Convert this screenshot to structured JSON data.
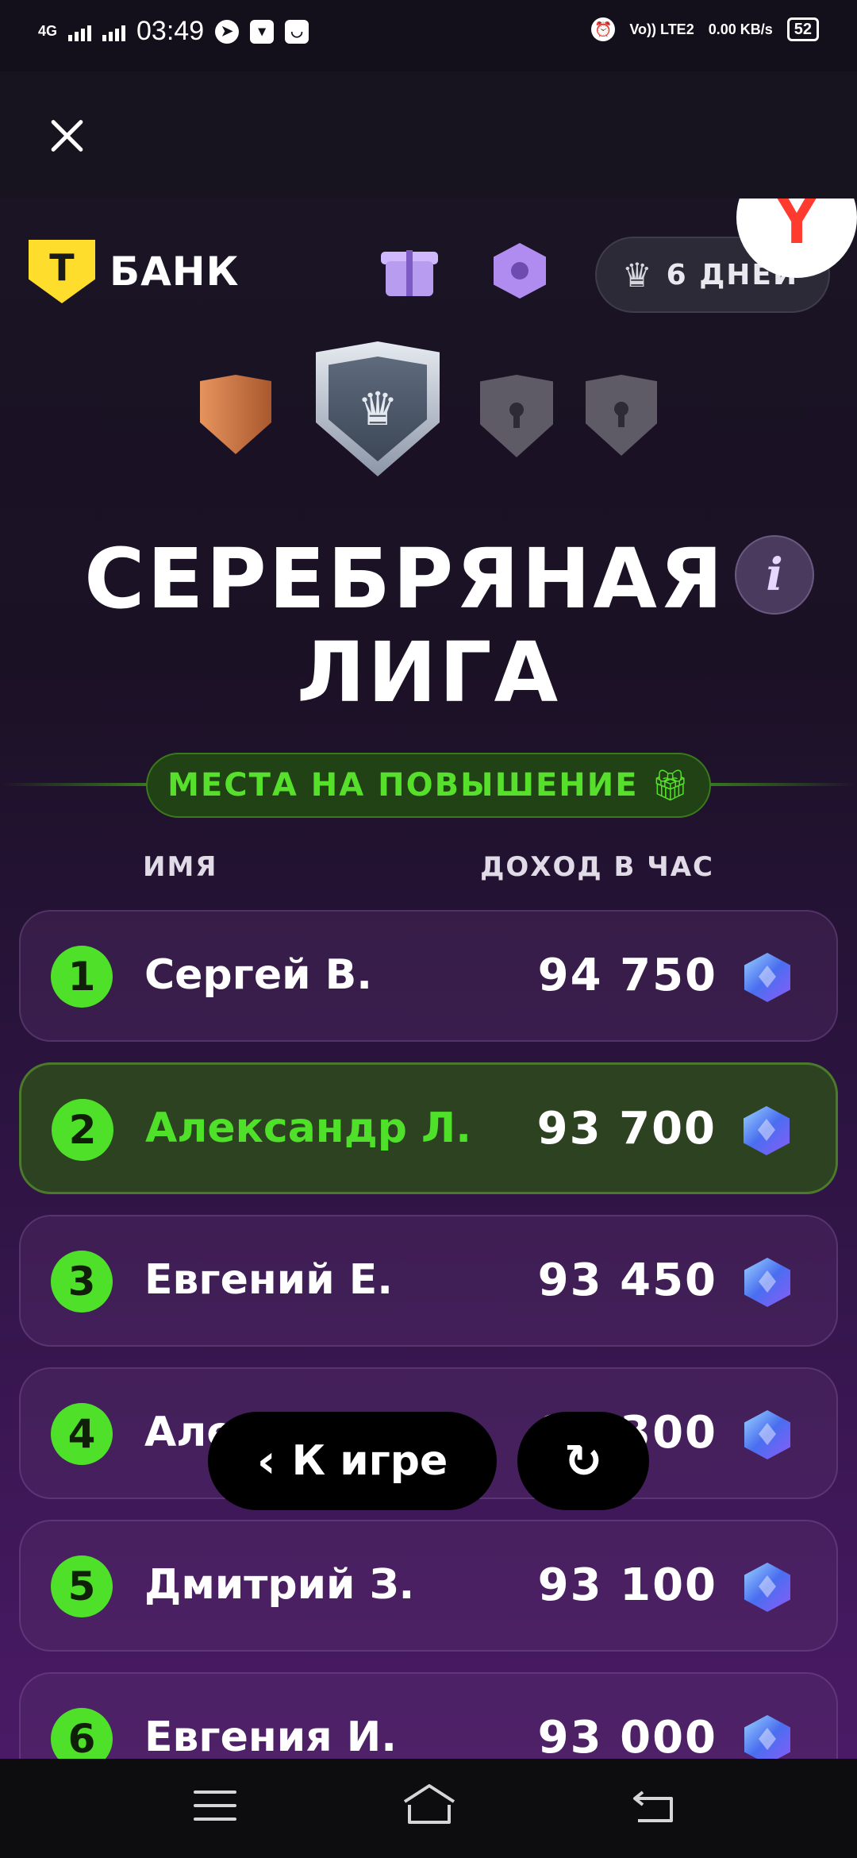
{
  "status_bar": {
    "network": "4G",
    "time": "03:49",
    "volte": "Vo)) LTE2",
    "speed": "0.00 KB/s",
    "battery": "52"
  },
  "header": {
    "brand": "БАНК",
    "brand_mark": "Т",
    "days_left": "6 ДНЕЙ",
    "yandex_mark": "Y"
  },
  "league": {
    "title_line1": "СЕРЕБРЯНАЯ",
    "title_line2": "ЛИГА",
    "info_symbol": "i",
    "promotion_label": "МЕСТА НА ПОВЫШЕНИЕ",
    "colors": {
      "accent_green": "#4fe12a",
      "silver": "#c8cfd9",
      "bronze": "#d07a45"
    }
  },
  "table": {
    "col_name": "ИМЯ",
    "col_income": "ДОХОД В ЧАС",
    "rows": [
      {
        "rank": "1",
        "name": "Сергей В.",
        "income": "94 750",
        "highlighted": false
      },
      {
        "rank": "2",
        "name": "Александр Л.",
        "income": "93 700",
        "highlighted": true
      },
      {
        "rank": "3",
        "name": "Евгений Е.",
        "income": "93 450",
        "highlighted": false
      },
      {
        "rank": "4",
        "name": "Алексей Б.",
        "income": "93 300",
        "highlighted": false
      },
      {
        "rank": "5",
        "name": "Дмитрий З.",
        "income": "93 100",
        "highlighted": false
      },
      {
        "rank": "6",
        "name": "Евгения И.",
        "income": "93 000",
        "highlighted": false
      }
    ]
  },
  "actions": {
    "back_label": "К игре",
    "back_icon": "chevron-left-icon",
    "refresh_icon": "refresh-icon"
  }
}
